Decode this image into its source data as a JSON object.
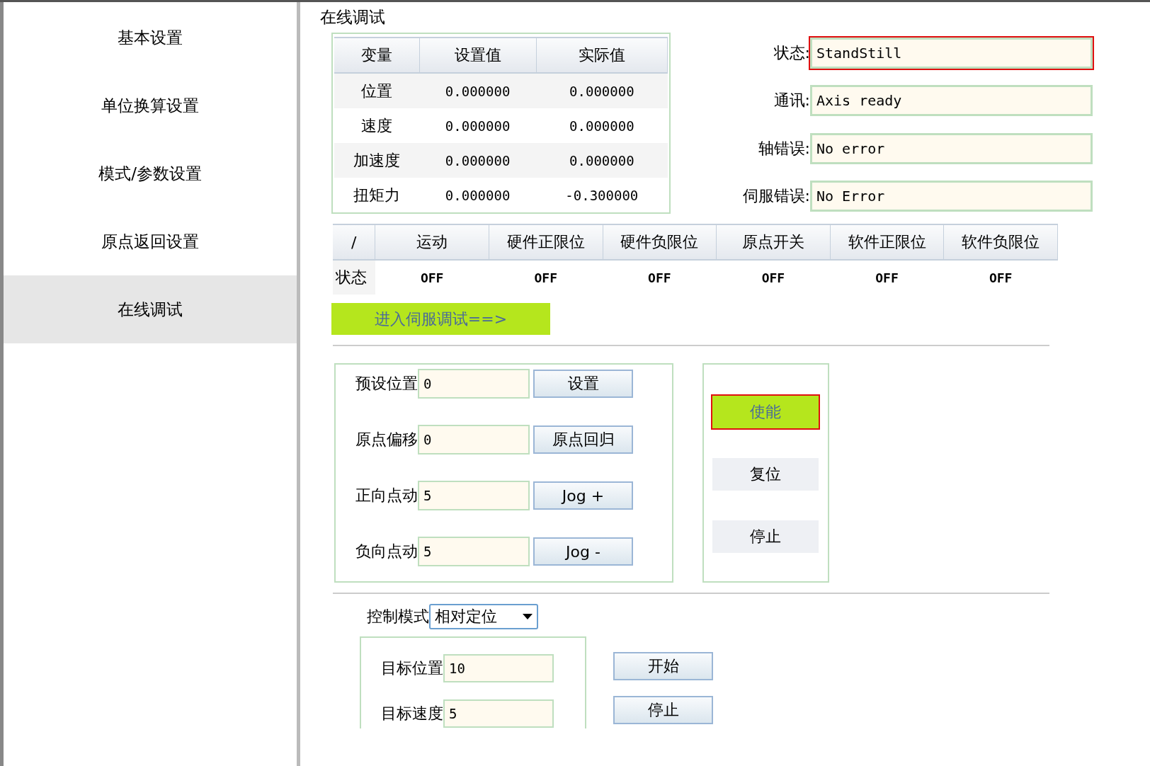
{
  "sidebar": {
    "items": [
      {
        "label": "基本设置",
        "selected": false
      },
      {
        "label": "单位换算设置",
        "selected": false
      },
      {
        "label": "模式/参数设置",
        "selected": false
      },
      {
        "label": "原点返回设置",
        "selected": false
      },
      {
        "label": "在线调试",
        "selected": true
      }
    ]
  },
  "page_title": "在线调试",
  "variables": {
    "columns": [
      "变量",
      "设置值",
      "实际值"
    ],
    "rows": [
      [
        "位置",
        "0.000000",
        "0.000000"
      ],
      [
        "速度",
        "0.000000",
        "0.000000"
      ],
      [
        "加速度",
        "0.000000",
        "0.000000"
      ],
      [
        "扭矩力",
        "0.000000",
        "-0.300000"
      ]
    ]
  },
  "status_fields": [
    {
      "label": "状态:",
      "value": "StandStill",
      "highlighted": true
    },
    {
      "label": "通讯:",
      "value": "Axis ready",
      "highlighted": false
    },
    {
      "label": "轴错误:",
      "value": "No error",
      "highlighted": false
    },
    {
      "label": "伺服错误:",
      "value": "No Error",
      "highlighted": false
    }
  ],
  "signals": {
    "columns": [
      "/",
      "运动",
      "硬件正限位",
      "硬件负限位",
      "原点开关",
      "软件正限位",
      "软件负限位"
    ],
    "row_label": "状态",
    "values": [
      "OFF",
      "OFF",
      "OFF",
      "OFF",
      "OFF",
      "OFF"
    ]
  },
  "servo_debug_button": "进入伺服调试==>",
  "jog_rows": [
    {
      "label": "预设位置",
      "value": "0",
      "button": "设置"
    },
    {
      "label": "原点偏移",
      "value": "0",
      "button": "原点回归"
    },
    {
      "label": "正向点动",
      "value": "5",
      "button": "Jog +"
    },
    {
      "label": "负向点动",
      "value": "5",
      "button": "Jog -"
    }
  ],
  "axis_buttons": [
    {
      "label": "使能",
      "active": true,
      "highlighted": true
    },
    {
      "label": "复位",
      "active": false,
      "highlighted": false
    },
    {
      "label": "停止",
      "active": false,
      "highlighted": false
    }
  ],
  "control_mode": {
    "label": "控制模式",
    "value": "相对定位"
  },
  "targets": [
    {
      "label": "目标位置",
      "value": "10"
    },
    {
      "label": "目标速度",
      "value": "5"
    }
  ],
  "motion_buttons": [
    "开始",
    "停止"
  ]
}
